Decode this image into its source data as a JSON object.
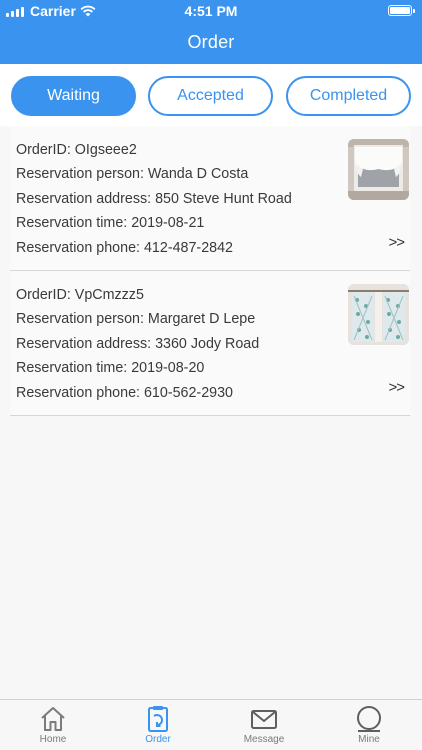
{
  "statusbar": {
    "carrier": "Carrier",
    "time": "4:51 PM"
  },
  "header": {
    "title": "Order",
    "color": "#3a93ee"
  },
  "tabs": [
    {
      "label": "Waiting",
      "active": true
    },
    {
      "label": "Accepted",
      "active": false
    },
    {
      "label": "Completed",
      "active": false
    }
  ],
  "orders": [
    {
      "id_line": "OrderID: OIgseee2",
      "person_line": "Reservation person: Wanda D Costa",
      "address_line": "Reservation address: 850 Steve Hunt Road",
      "time_line": "Reservation time: 2019-08-21",
      "phone_line": "Reservation phone: 412-487-2842",
      "arrow": ">>",
      "thumb_icon": "white-curtain-thumbnail"
    },
    {
      "id_line": "OrderID: VpCmzzz5",
      "person_line": "Reservation person: Margaret D Lepe",
      "address_line": "Reservation address: 3360 Jody Road",
      "time_line": "Reservation time: 2019-08-20",
      "phone_line": "Reservation phone: 610-562-2930",
      "arrow": ">>",
      "thumb_icon": "patterned-curtain-thumbnail"
    }
  ],
  "tabbar": {
    "items": [
      {
        "label": "Home",
        "icon": "home-icon",
        "active": false
      },
      {
        "label": "Order",
        "icon": "order-icon",
        "active": true
      },
      {
        "label": "Message",
        "icon": "message-icon",
        "active": false
      },
      {
        "label": "Mine",
        "icon": "mine-icon",
        "active": false
      }
    ]
  }
}
